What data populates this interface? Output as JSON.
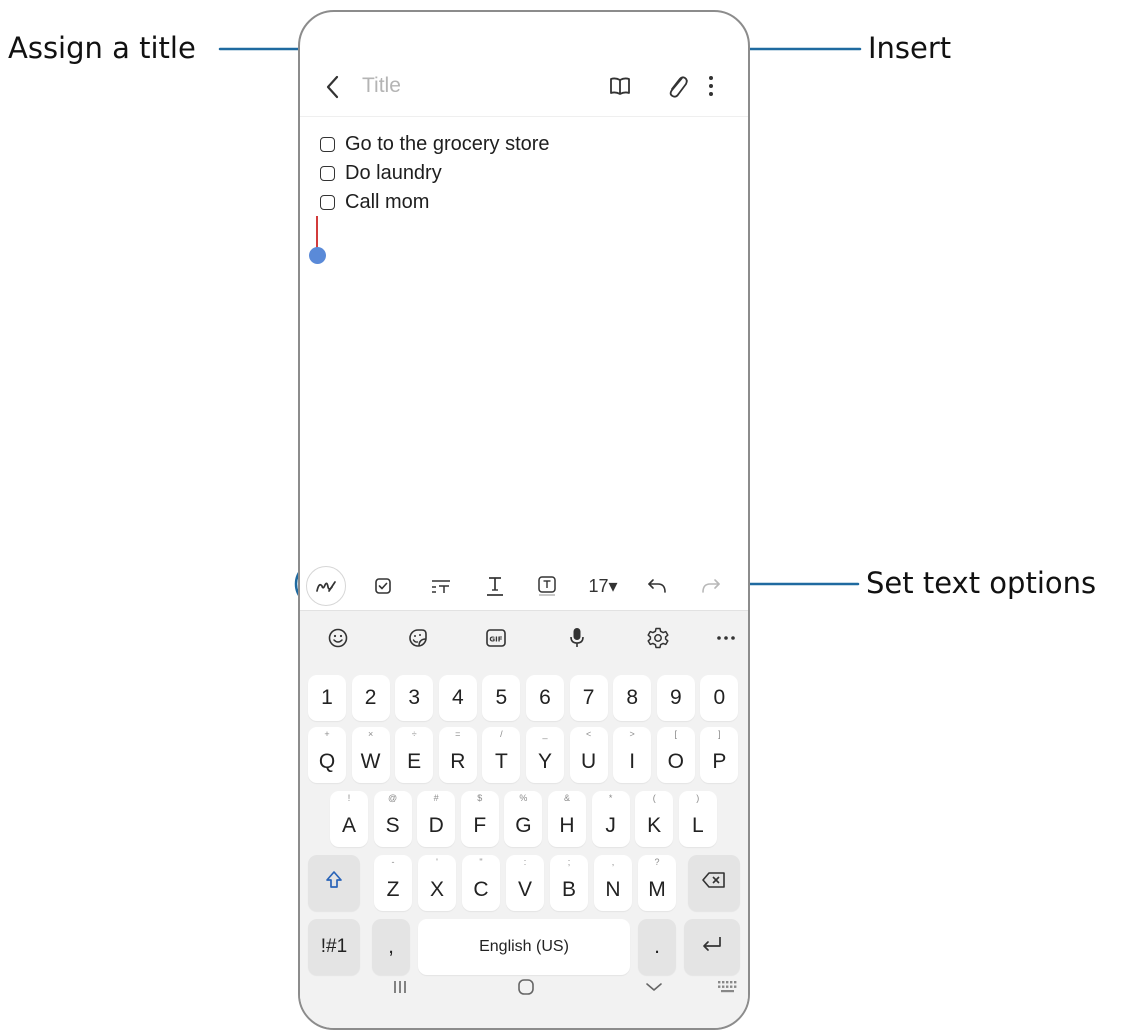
{
  "callouts": {
    "assign_title": "Assign a title",
    "insert": "Insert",
    "set_text_options": "Set text options"
  },
  "header": {
    "title_placeholder": "Title",
    "icons": [
      "back-icon",
      "reader-mode-icon",
      "attach-icon",
      "more-options-icon"
    ]
  },
  "checklist": [
    {
      "label": "Go to the grocery store",
      "checked": false
    },
    {
      "label": "Do laundry",
      "checked": false
    },
    {
      "label": "Call mom",
      "checked": false
    }
  ],
  "text_toolbar": {
    "icons": [
      "handwriting-pen-icon",
      "checkbox-icon",
      "paragraph-style-icon",
      "text-style-icon",
      "text-box-icon",
      "undo-icon",
      "redo-icon"
    ],
    "font_size": "17▾"
  },
  "keyboard": {
    "toolbar_icons": [
      "emoji-icon",
      "sticker-icon",
      "gif-icon",
      "microphone-icon",
      "settings-icon",
      "more-icon"
    ],
    "number_row": [
      "1",
      "2",
      "3",
      "4",
      "5",
      "6",
      "7",
      "8",
      "9",
      "0"
    ],
    "row1": {
      "keys": [
        "Q",
        "W",
        "E",
        "R",
        "T",
        "Y",
        "U",
        "I",
        "O",
        "P"
      ],
      "secondary": [
        "+",
        "×",
        "÷",
        "=",
        "/",
        "_",
        "<",
        ">",
        "[",
        "]"
      ]
    },
    "row2": {
      "keys": [
        "A",
        "S",
        "D",
        "F",
        "G",
        "H",
        "J",
        "K",
        "L"
      ],
      "secondary": [
        "!",
        "@",
        "#",
        "$",
        "%",
        "&",
        "*",
        "(",
        ")"
      ]
    },
    "row3": {
      "keys": [
        "Z",
        "X",
        "C",
        "V",
        "B",
        "N",
        "M"
      ],
      "secondary": [
        "-",
        "'",
        "\"",
        ":",
        ";",
        ",",
        "?"
      ]
    },
    "symbols_key": "!#1",
    "comma_key": ",",
    "space_label": "English (US)",
    "period_key": ".",
    "shift_icon": "shift-icon",
    "backspace_icon": "backspace-icon",
    "enter_icon": "enter-icon"
  },
  "navbar": {
    "icons": [
      "recents-icon",
      "home-icon",
      "hide-keyboard-icon",
      "keyboard-switch-icon"
    ]
  },
  "colors": {
    "callout_line": "#1f6aa0",
    "cursor_line": "#d23b3b",
    "cursor_handle": "#5a8ad8",
    "keyboard_bg": "#f2f2f2",
    "key_bg": "#ffffff",
    "function_key_bg": "#e4e4e4"
  }
}
